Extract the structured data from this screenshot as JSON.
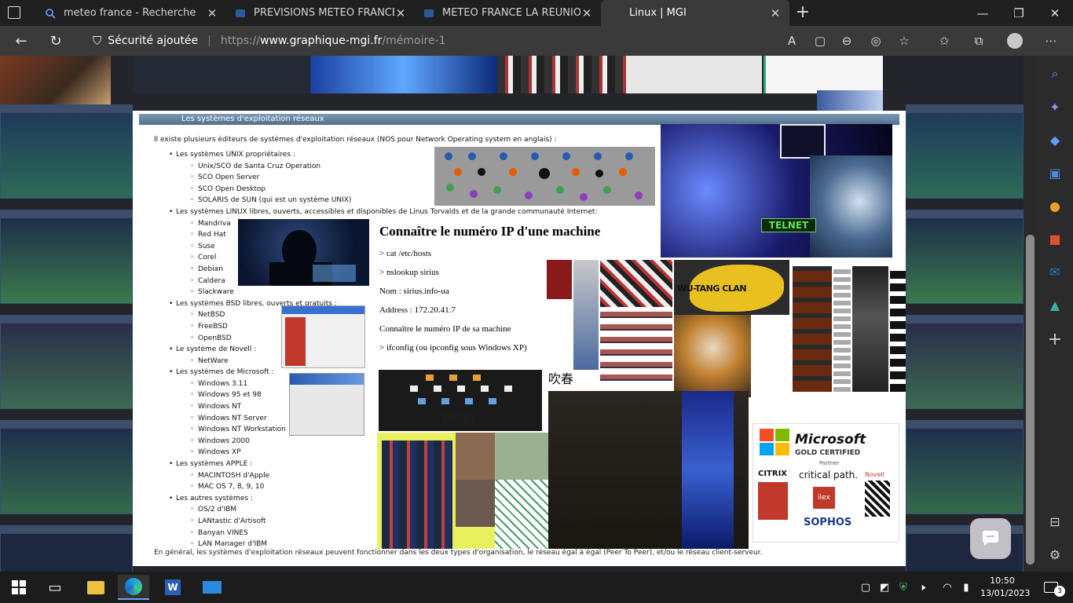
{
  "browser": {
    "tabs": [
      {
        "title": "meteo france - Recherche",
        "icon": "search-icon"
      },
      {
        "title": "PREVISIONS METEO FRANCE - Si",
        "icon": "weather-site-icon"
      },
      {
        "title": "METEO FRANCE LA RÉUNION pa",
        "icon": "weather-site-icon"
      },
      {
        "title": "Linux | MGI",
        "icon": "linux-icon"
      }
    ],
    "security_label": "Sécurité ajoutée",
    "url_prefix": "https://",
    "url_domain": "www.graphique-mgi.fr",
    "url_path": "/mémoire-1"
  },
  "page": {
    "section_title": "Les systèmes d'exploitation réseaux",
    "intro": "Il existe plusieurs éditeurs de systèmes d'exploitation réseaux (NOS pour Network Operating system en anglais) :",
    "categories": [
      {
        "label": "Les systèmes UNIX propriétaires :",
        "items": [
          "Unix/SCO de Santa Cruz Operation",
          "SCO Open Server",
          "SCO Open Desktop",
          "SOLARIS de SUN (qui est un système UNIX)"
        ]
      },
      {
        "label": "Les systèmes LINUX libres, ouverts, accessibles et disponibles de Linus Torvalds et de la grande communauté Internet:",
        "items": [
          "Mandriva",
          "Red Hat",
          "Suse",
          "Corel",
          "Debian",
          "Caldera",
          "Slackware"
        ]
      },
      {
        "label": "Les systèmes BSD libres, ouverts et gratuits :",
        "items": [
          "NetBSD",
          "FreeBSD",
          "OpenBSD"
        ]
      },
      {
        "label": "Le système de Novell :",
        "items": [
          "NetWare"
        ]
      },
      {
        "label": "Les systèmes de Microsoft :",
        "items": [
          "Windows 3.11",
          "Windows 95 et 98",
          "Windows NT",
          "Windows NT Server",
          "Windows NT Workstation",
          "Windows 2000",
          "Windows XP"
        ]
      },
      {
        "label": "Les systèmes APPLE :",
        "items": [
          "MACINTOSH d'Apple",
          "MAC OS 7, 8, 9, 10"
        ]
      },
      {
        "label": "Les autres systèmes :",
        "items": [
          "OS/2 d'IBM",
          "LANtastic d'Artisoft",
          "Banyan VINES",
          "LAN Manager d'IBM"
        ]
      }
    ],
    "ip": {
      "title": "Connaître le numéro IP d'une machine",
      "lines": [
        "> cat /etc/hosts",
        "> nslookup sirius",
        "Nom : sirius.info-ua",
        "Address : 172.20.41.7",
        "Connaître le numéro IP de sa machine",
        "> ifconfig (ou ipconfig sous Windows XP)"
      ]
    },
    "footer": "En général, les systèmes d'exploitation réseaux peuvent fonctionner dans les deux types d'organisation, le réseau égal à égal (Peer To Peer), et/ou le réseau client-serveur.",
    "image_labels": {
      "telnet": "TELNET",
      "wutang": "WU-TANG CLAN",
      "debian": "debian",
      "ms_brand": "Microsoft",
      "ms_gold": "GOLD CERTIFIED",
      "ms_partner": "Partner",
      "critical": "critical path.",
      "citrix": "CITRIX",
      "novell": "Novell",
      "sophos": "SOPHOS",
      "ilex": "ilex",
      "chinese": "吹春"
    }
  },
  "taskbar": {
    "time": "10:50",
    "date": "13/01/2023",
    "notification_count": "3"
  }
}
